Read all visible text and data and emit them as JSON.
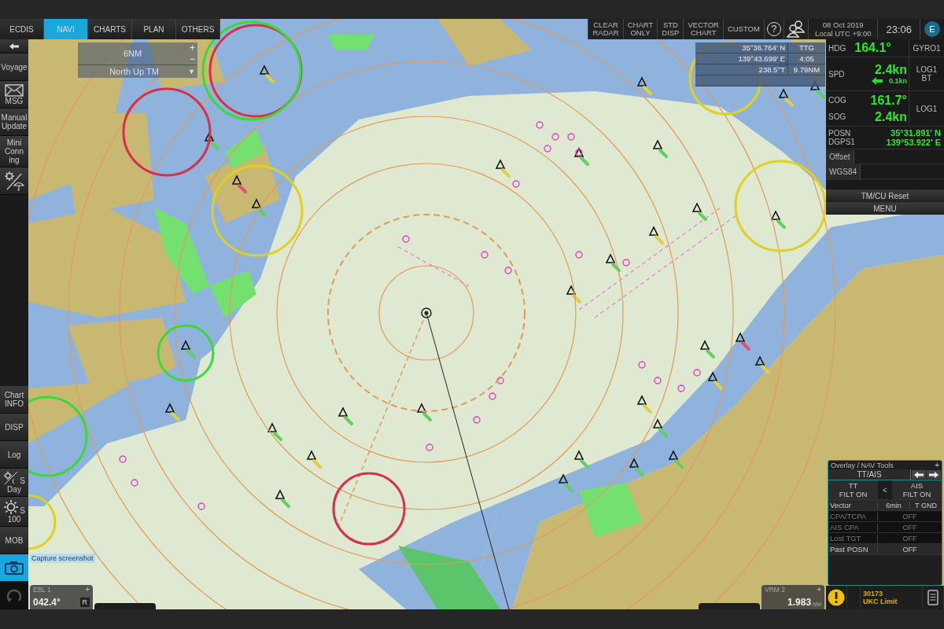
{
  "top_tabs": [
    {
      "label": "ECDIS",
      "selected": false
    },
    {
      "label": "NAVI",
      "selected": true
    },
    {
      "label": "CHARTS",
      "selected": false
    },
    {
      "label": "PLAN",
      "selected": false
    },
    {
      "label": "OTHERS",
      "selected": false
    }
  ],
  "toolbar": {
    "buttons": [
      {
        "kind": "text",
        "lines": [
          "CLEAR",
          "RADAR"
        ]
      },
      {
        "kind": "text",
        "lines": [
          "CHART",
          "ONLY"
        ]
      },
      {
        "kind": "text",
        "lines": [
          "STD",
          "DISP"
        ]
      },
      {
        "kind": "text",
        "lines": [
          "VECTOR",
          "CHART"
        ]
      },
      {
        "kind": "text",
        "lines": [
          "CUSTOM"
        ]
      },
      {
        "kind": "help",
        "lines": [
          "?"
        ]
      },
      {
        "kind": "people"
      }
    ],
    "date": "08 Oct 2019",
    "zone": "Local UTC +9:00",
    "time": "23:06",
    "user_badge": "E"
  },
  "sidebar": {
    "top": [
      {
        "kind": "arrow",
        "selected": false
      },
      {
        "kind": "text",
        "lines": [
          "Voyage"
        ],
        "selected": false
      },
      {
        "kind": "mail",
        "lines": [
          "MSG"
        ],
        "selected": false
      },
      {
        "kind": "text",
        "lines": [
          "Manual",
          "Update"
        ],
        "selected": false
      },
      {
        "kind": "text",
        "lines": [
          "Mini",
          "Conn",
          "ing"
        ],
        "selected": false
      },
      {
        "kind": "tools",
        "selected": false
      }
    ],
    "bottom": [
      {
        "kind": "text",
        "lines": [
          "Chart",
          "INFO"
        ],
        "selected": false
      },
      {
        "kind": "text",
        "lines": [
          "DISP"
        ],
        "selected": false
      },
      {
        "kind": "text",
        "lines": [
          "Log"
        ],
        "selected": false
      },
      {
        "kind": "daynight",
        "lines": [
          "S",
          "Day"
        ],
        "selected": false
      },
      {
        "kind": "brightness",
        "lines": [
          "S",
          "100"
        ],
        "selected": false
      },
      {
        "kind": "text",
        "lines": [
          "MOB"
        ],
        "selected": false
      },
      {
        "kind": "camera",
        "selected": true
      },
      {
        "kind": "undo",
        "selected": false
      }
    ]
  },
  "tooltip": "Capture screenshot",
  "scale_panel": {
    "range": "6NM",
    "orientation": "North Up TM",
    "plus": "+",
    "minus": "−",
    "dropdown": "▼"
  },
  "cursor_panel": {
    "lat": "35°36.764' N",
    "lon": "139°43.699' E",
    "bearing": "238.5°T",
    "ttg_label": "TTG",
    "ttg": "4:05",
    "distance": "9.79NM"
  },
  "nav_panel": {
    "heading": {
      "label": "HDG",
      "value": "164.1°",
      "source": "GYRO1"
    },
    "speed": {
      "label": "SPD",
      "value": "2.4kn",
      "drift": "0.1kn",
      "source": [
        "LOG1",
        "BT"
      ]
    },
    "course": {
      "cog_label": "COG",
      "cog": "161.7°",
      "sog_label": "SOG",
      "sog": "2.4kn",
      "source": "LOG1"
    },
    "position": {
      "label": "POSN",
      "sensor": "DGPS1",
      "lat": "35°31.891' N",
      "lon": "139°53.922' E"
    },
    "offset": "Offset",
    "datum": "WGS84",
    "buttons": [
      "TM/CU Reset",
      "MENU"
    ]
  },
  "overlay_panel": {
    "title": "Overlay / NAV Tools",
    "plus": "+",
    "tab": "TT/AIS",
    "filters": [
      {
        "name": "TT",
        "state": "FILT ON"
      },
      {
        "name": "AIS",
        "state": "FILT ON"
      }
    ],
    "swap": "<",
    "rows": [
      {
        "label": "Vector",
        "values": [
          "6min",
          "T GND"
        ],
        "disabled": false
      },
      {
        "label": "CPA/TCPA",
        "values": [
          "OFF"
        ],
        "disabled": true
      },
      {
        "label": "AIS CPA",
        "values": [
          "OFF"
        ],
        "disabled": true
      },
      {
        "label": "Lost TGT",
        "values": [
          "OFF"
        ],
        "disabled": true
      },
      {
        "label": "Past POSN",
        "values": [
          "OFF"
        ],
        "disabled": false
      }
    ]
  },
  "ebl": {
    "label": "EBL 1",
    "plus": "+",
    "value": "042.4°",
    "mode": "R"
  },
  "vrm": {
    "label": "VRM 2",
    "plus": "+",
    "value": "1.983",
    "unit": "NM"
  },
  "alert": {
    "code": "30173",
    "text": "UKC Limit"
  }
}
